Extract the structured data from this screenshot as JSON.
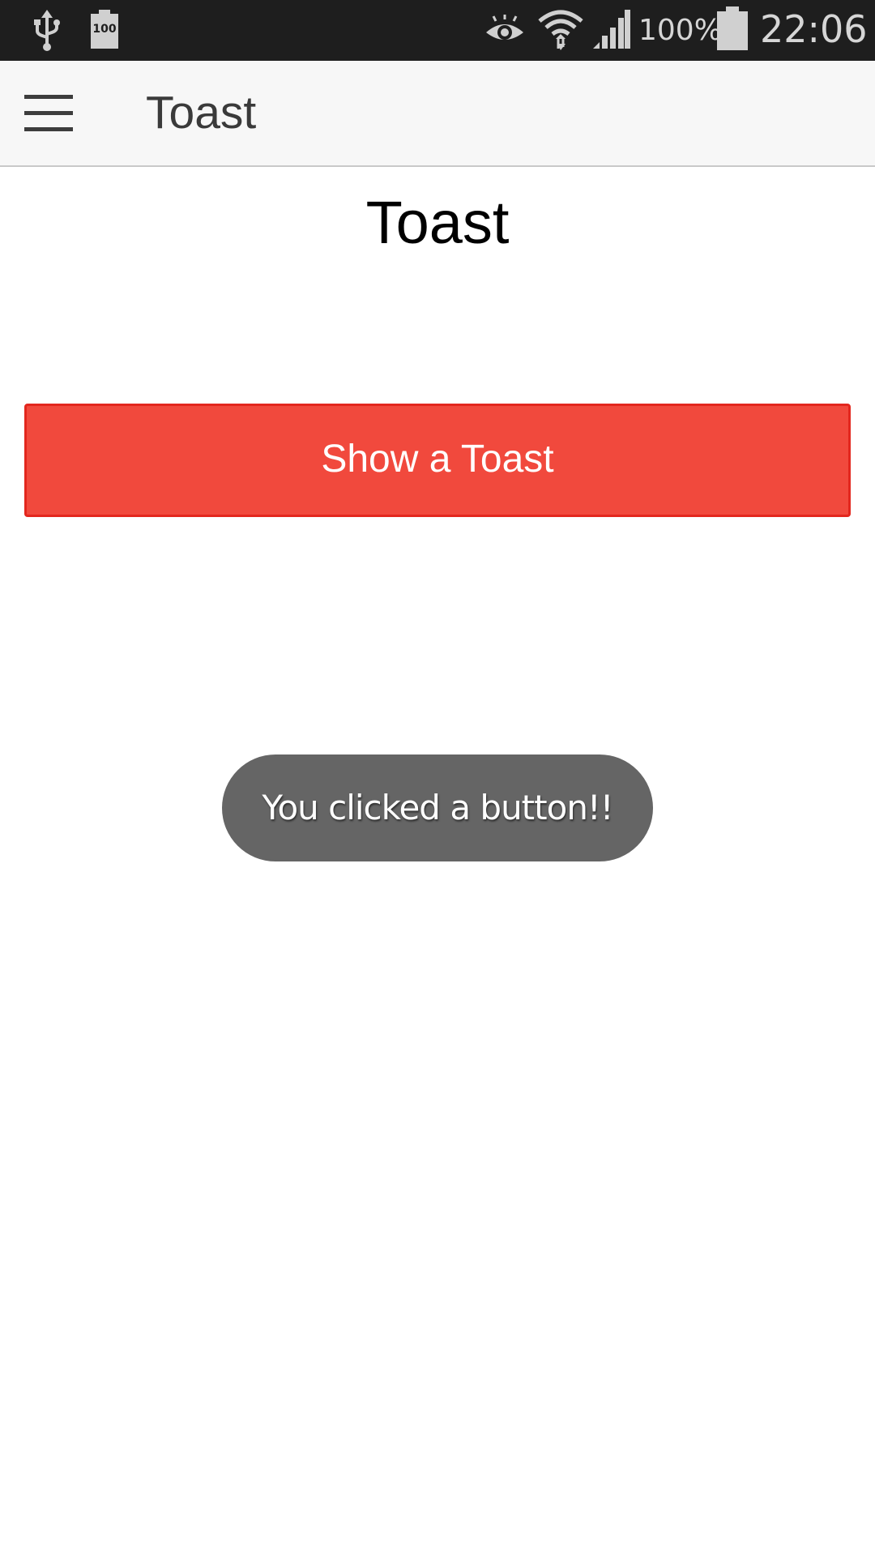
{
  "status_bar": {
    "battery_small_label": "100",
    "battery_percent": "100%",
    "time": "22:06",
    "icons": [
      "usb-icon",
      "battery-small-icon",
      "eye-icon",
      "wifi-icon",
      "signal-icon",
      "battery-icon"
    ]
  },
  "app_bar": {
    "title": "Toast",
    "menu_icon": "hamburger-menu-icon"
  },
  "main": {
    "heading": "Toast",
    "show_toast_button": "Show a Toast"
  },
  "toast": {
    "message": "You clicked a button!!"
  },
  "colors": {
    "status_bar_bg": "#1e1e1e",
    "app_bar_bg": "#f7f7f7",
    "button_bg": "#f1493d",
    "button_border": "#e3271e",
    "toast_bg": "#656565"
  }
}
